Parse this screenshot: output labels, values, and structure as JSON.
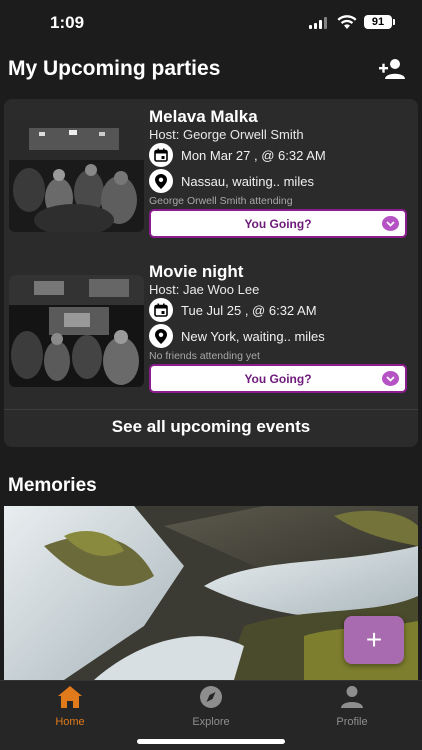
{
  "status_bar": {
    "time": "1:09",
    "battery": "91"
  },
  "header": {
    "title": "My Upcoming parties",
    "add_friend_icon": "person-add-icon"
  },
  "parties": [
    {
      "title": "Melava Malka",
      "host": "Host: George Orwell Smith",
      "date": "Mon Mar 27 ,  @ 6:32 AM",
      "location": "Nassau, waiting.. miles",
      "attending": "George Orwell Smith attending",
      "rsvp": "You Going?"
    },
    {
      "title": "Movie night",
      "host": "Host: Jae Woo Lee",
      "date": "Tue Jul 25 ,  @ 6:32 AM",
      "location": "New York, waiting.. miles",
      "attending": "No friends attending yet",
      "rsvp": "You Going?"
    }
  ],
  "see_all": "See all upcoming events",
  "memories": {
    "title": "Memories"
  },
  "fab": {
    "label": "+"
  },
  "tabs": [
    {
      "label": "Home",
      "icon": "home-icon",
      "active": true
    },
    {
      "label": "Explore",
      "icon": "compass-icon",
      "active": false
    },
    {
      "label": "Profile",
      "icon": "person-icon",
      "active": false
    }
  ],
  "colors": {
    "background": "#1c1c1c",
    "card": "#2b2b2b",
    "accent_purple": "#8b1d8e",
    "fab": "#a86bb0",
    "active_tab": "#e07a1a",
    "inactive_tab": "#8e8e8e"
  }
}
